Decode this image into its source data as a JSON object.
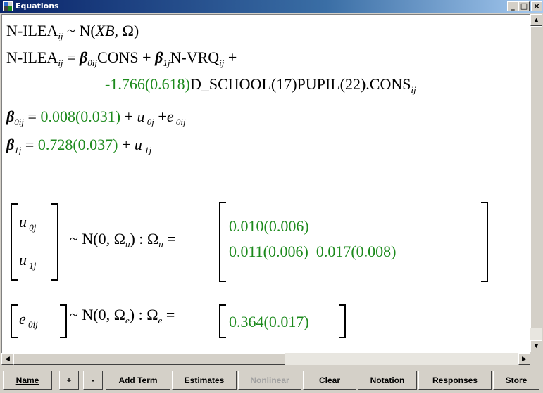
{
  "window": {
    "title": "Equations"
  },
  "equations": {
    "line1": {
      "lhs": "N-ILEA",
      "lhs_sub": "ij",
      "rest": " ~ N(",
      "xb": "XB,",
      "omega": " Ω)"
    },
    "line2": {
      "lhs": "N-ILEA",
      "lhs_sub": "ij",
      "eq": " = ",
      "b0": "β",
      "b0_sub": "0ij",
      "cons": "CONS + ",
      "b1": "β",
      "b1_sub": "1j",
      "vrq": "N-VRQ",
      "vrq_sub": "ij",
      "plus": " +"
    },
    "line3": {
      "coef": "-1.766(0.618)",
      "term": "D_SCHOOL(17)PUPIL(22).CONS",
      "term_sub": "ij"
    },
    "line4": {
      "beta": "β",
      "beta_sub": "0ij",
      "eq": " = ",
      "val": "0.008(0.031)",
      "plus1": " + ",
      "u": "u",
      "u_sub": " 0j",
      "plus2": " +",
      "e": "e",
      "e_sub": " 0ij"
    },
    "line5": {
      "beta": "β",
      "beta_sub": "1j",
      "eq": " = ",
      "val": "0.728(0.037)",
      "plus": " + ",
      "u": "u",
      "u_sub": " 1j"
    },
    "level2": {
      "u0": "u",
      "u0_sub": " 0j",
      "u1": "u",
      "u1_sub": " 1j",
      "dist": "~ N(0,  Ω",
      "dist_sub": "u",
      "dist_close": ")  :  Ω",
      "omega_sub": "u",
      "eq": " =",
      "row1": "0.010(0.006)",
      "row2a": "0.011(0.006)",
      "row2b": "0.017(0.008)"
    },
    "level1": {
      "e0": "e",
      "e0_sub": " 0ij",
      "dist": "~ N(0,  Ω",
      "dist_sub": "e",
      "dist_close": ")  :  Ω",
      "omega_sub": "e",
      "eq": " =",
      "row1": "0.364(0.017)"
    }
  },
  "toolbar": {
    "name": "Name",
    "plus": "+",
    "minus": "-",
    "add_term": "Add Term",
    "estimates": "Estimates",
    "nonlinear": "Nonlinear",
    "clear": "Clear",
    "notation": "Notation",
    "responses": "Responses",
    "store": "Store"
  },
  "colors": {
    "estimate_green": "#1c8a1c",
    "titlebar": "#0a246a"
  },
  "icons": [
    "app-icon",
    "minimize-icon",
    "maximize-icon",
    "close-icon",
    "scroll-up-icon",
    "scroll-down-icon",
    "scroll-left-icon",
    "scroll-right-icon"
  ]
}
